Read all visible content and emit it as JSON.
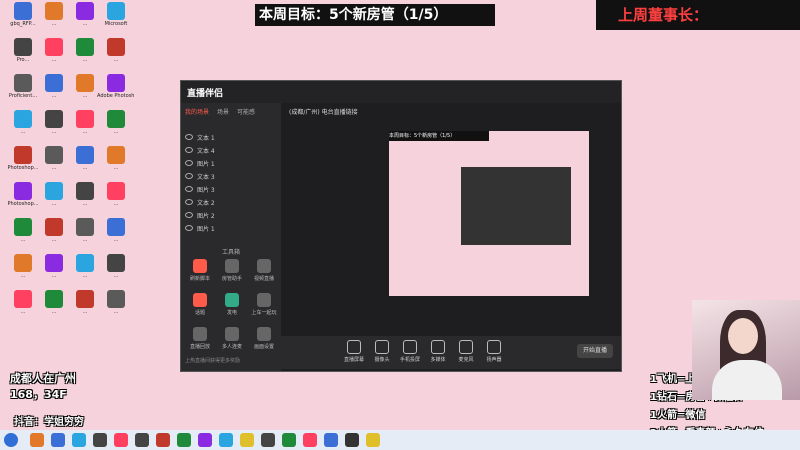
{
  "banners": {
    "weekly_goal": "本周目标：5个新房管（1/5）",
    "last_week_top": "上周董事长："
  },
  "desktop_icons": [
    {
      "label": "gbq_RFP..."
    },
    {
      "label": "..."
    },
    {
      "label": "..."
    },
    {
      "label": "Microsoft"
    },
    {
      "label": "Pro..."
    },
    {
      "label": "..."
    },
    {
      "label": "..."
    },
    {
      "label": "..."
    },
    {
      "label": "Proficient..."
    },
    {
      "label": "..."
    },
    {
      "label": "..."
    },
    {
      "label": "Adobe Photosh..."
    },
    {
      "label": "..."
    },
    {
      "label": "..."
    },
    {
      "label": "..."
    },
    {
      "label": "..."
    },
    {
      "label": "Photoshop..."
    },
    {
      "label": "..."
    },
    {
      "label": "..."
    },
    {
      "label": "..."
    },
    {
      "label": "Photoshop..."
    },
    {
      "label": "..."
    },
    {
      "label": "..."
    },
    {
      "label": "..."
    },
    {
      "label": "..."
    },
    {
      "label": "..."
    },
    {
      "label": "..."
    },
    {
      "label": "..."
    },
    {
      "label": "..."
    },
    {
      "label": "..."
    },
    {
      "label": "..."
    },
    {
      "label": "..."
    },
    {
      "label": "..."
    },
    {
      "label": "..."
    },
    {
      "label": "..."
    },
    {
      "label": "..."
    }
  ],
  "app": {
    "logo": "直播伴侣",
    "tabs": [
      "我的场景",
      "场景",
      "可能感"
    ],
    "sources": [
      "文本 1",
      "文本 4",
      "图片 1",
      "文本 3",
      "图片 3",
      "文本 2",
      "图片 2",
      "图片 1"
    ],
    "tools_title": "工具箱",
    "tools": [
      "刷新脚本",
      "房管助手",
      "视频直播",
      "话题",
      "发电",
      "上车一起玩",
      "直播回放",
      "多人连麦",
      "画面设置"
    ],
    "stream_title": "(成都/广州) 电台直播链接",
    "bottom_buttons": [
      "直播屏幕",
      "摄像头",
      "手机投屏",
      "多媒体",
      "麦克风",
      "扬声器"
    ],
    "live_button": "开始直播",
    "tip": "上热直播间获得更多奖励"
  },
  "captions": {
    "left_1": "成都人在广州",
    "left_2": "168，34F",
    "left_3": "抖音：学姐穷穷",
    "right": [
      "1飞机=上车+游戏新友位",
      "1钻石=房管+微信群",
      "1火箭=微信",
      "2火箭=看素颜+永久车位"
    ]
  },
  "colors": {
    "desktop_bg": "#f6d3dc",
    "accent": "#ff5b4a"
  }
}
